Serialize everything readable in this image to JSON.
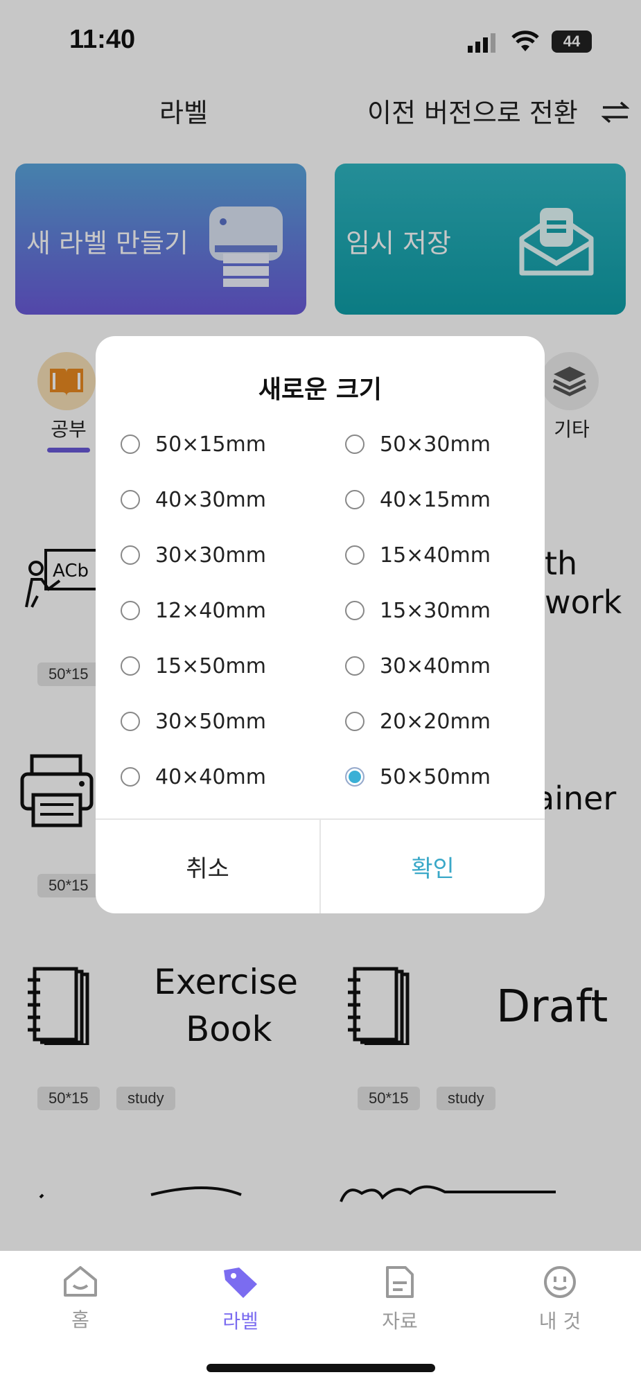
{
  "status_bar": {
    "time": "11:40",
    "battery": "44"
  },
  "header": {
    "title": "라벨",
    "switch_label": "이전 버전으로 전환"
  },
  "top_cards": {
    "new_label": "새 라벨 만들기",
    "draft": "임시 저장"
  },
  "categories": {
    "study": "공부",
    "other": "기타"
  },
  "templates": [
    {
      "text_lines": [
        "th",
        "work"
      ],
      "size": "50*15"
    },
    {
      "text_lines": [
        "ainer"
      ],
      "size": "50*15"
    },
    {
      "text_lines": [
        "Exercise",
        "Book"
      ],
      "size": "50*15",
      "tag": "study"
    },
    {
      "text_lines": [
        "Draft"
      ],
      "size": "50*15",
      "tag": "study"
    }
  ],
  "dialog": {
    "title": "새로운 크기",
    "options": [
      "50×15mm",
      "50×30mm",
      "40×30mm",
      "40×15mm",
      "30×30mm",
      "15×40mm",
      "12×40mm",
      "15×30mm",
      "15×50mm",
      "30×40mm",
      "30×50mm",
      "20×20mm",
      "40×40mm",
      "50×50mm"
    ],
    "selected": "50×50mm",
    "cancel": "취소",
    "confirm": "확인"
  },
  "bottom_nav": {
    "home": "홈",
    "label": "라벨",
    "data": "자료",
    "mine": "내 것"
  },
  "colors": {
    "accent": "#7b6cf0",
    "confirm": "#3aa8c8",
    "selected_radio": "#3ab0d6"
  }
}
